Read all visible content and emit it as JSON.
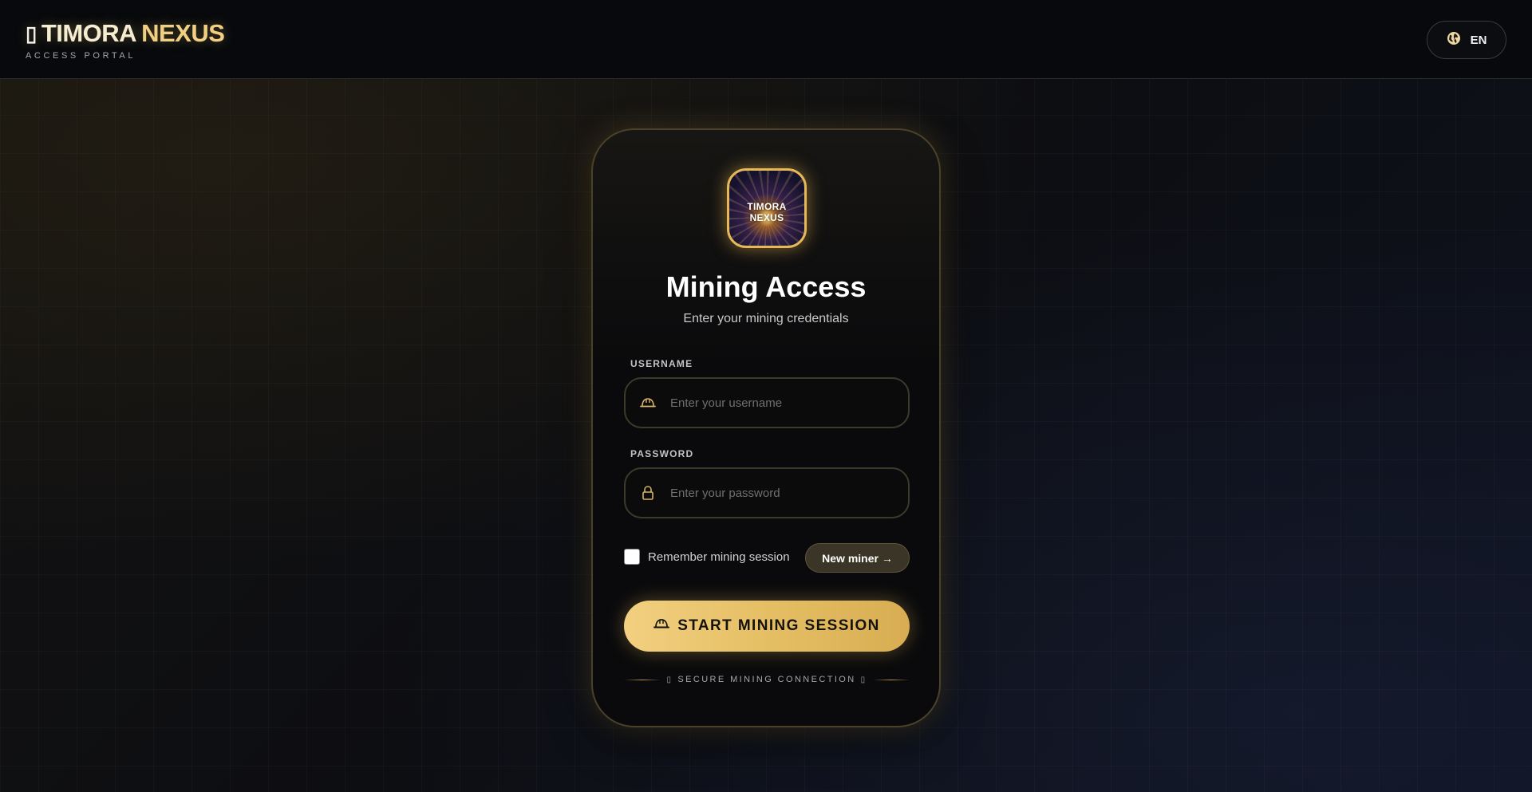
{
  "header": {
    "brand_glyph": "▯",
    "brand_word1": "TIMORA",
    "brand_word2": "NEXUS",
    "brand_subtitle": "ACCESS PORTAL",
    "language": "EN"
  },
  "card": {
    "logo_text": "TIMORA NEXUS",
    "title": "Mining Access",
    "subtitle": "Enter your mining credentials",
    "username": {
      "label": "USERNAME",
      "placeholder": "Enter your username",
      "value": "",
      "icon": "hard-hat-icon"
    },
    "password": {
      "label": "PASSWORD",
      "placeholder": "Enter your password",
      "value": "",
      "icon": "lock-icon"
    },
    "remember_label": "Remember mining session",
    "remember_checked": false,
    "new_miner_label": "New miner →",
    "start_label": "START MINING SESSION",
    "secure_glyph_left": "▯",
    "secure_text": "SECURE MINING CONNECTION",
    "secure_glyph_right": "▯"
  },
  "colors": {
    "accent_gold": "#e6b85a",
    "button_gold_start": "#f2d080",
    "button_gold_end": "#d8ad52",
    "background": "#0d0e12"
  }
}
